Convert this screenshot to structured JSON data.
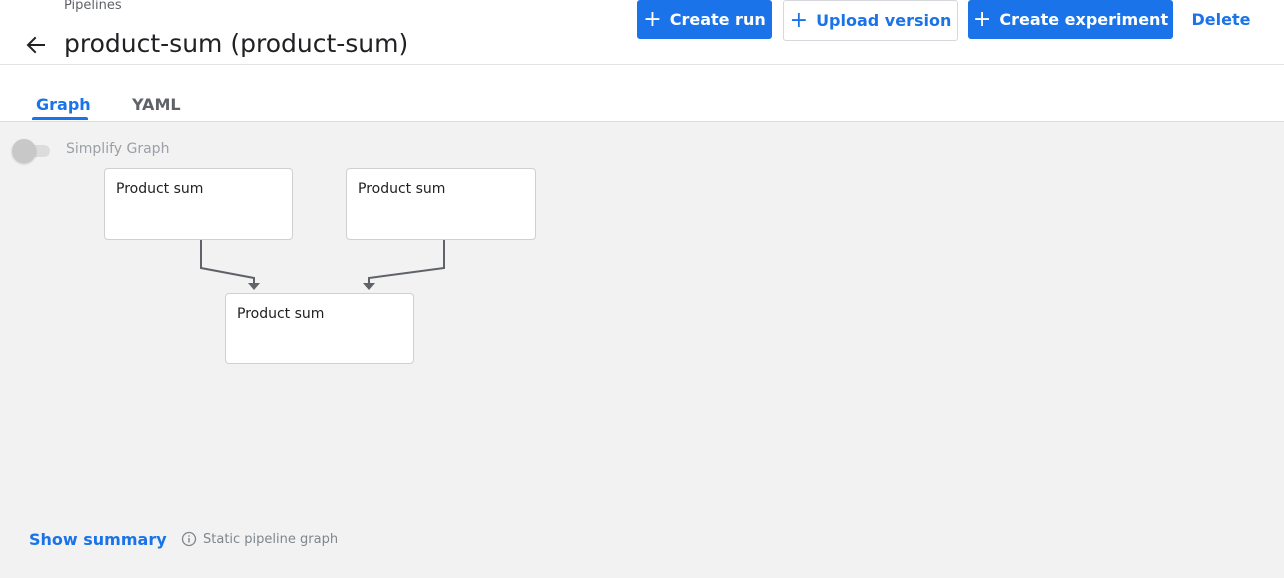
{
  "header": {
    "breadcrumb": "Pipelines",
    "title": "product-sum (product-sum)",
    "back_icon": "arrow-left-icon"
  },
  "actions": {
    "create_run": "Create run",
    "upload_version": "Upload version",
    "create_experiment": "Create experiment",
    "delete": "Delete",
    "plus_glyph": "+"
  },
  "tabs": [
    {
      "label": "Graph",
      "active": true
    },
    {
      "label": "YAML",
      "active": false
    }
  ],
  "graph": {
    "simplify_label": "Simplify Graph",
    "simplify_enabled": false,
    "nodes": [
      {
        "label": "Product sum"
      },
      {
        "label": "Product sum"
      },
      {
        "label": "Product sum"
      }
    ]
  },
  "footer": {
    "show_summary": "Show summary",
    "static_label": "Static pipeline graph",
    "info_icon": "info-icon"
  },
  "colors": {
    "accent": "#1a73e8",
    "canvas_bg": "#f2f2f2",
    "edge": "#5f6368"
  }
}
